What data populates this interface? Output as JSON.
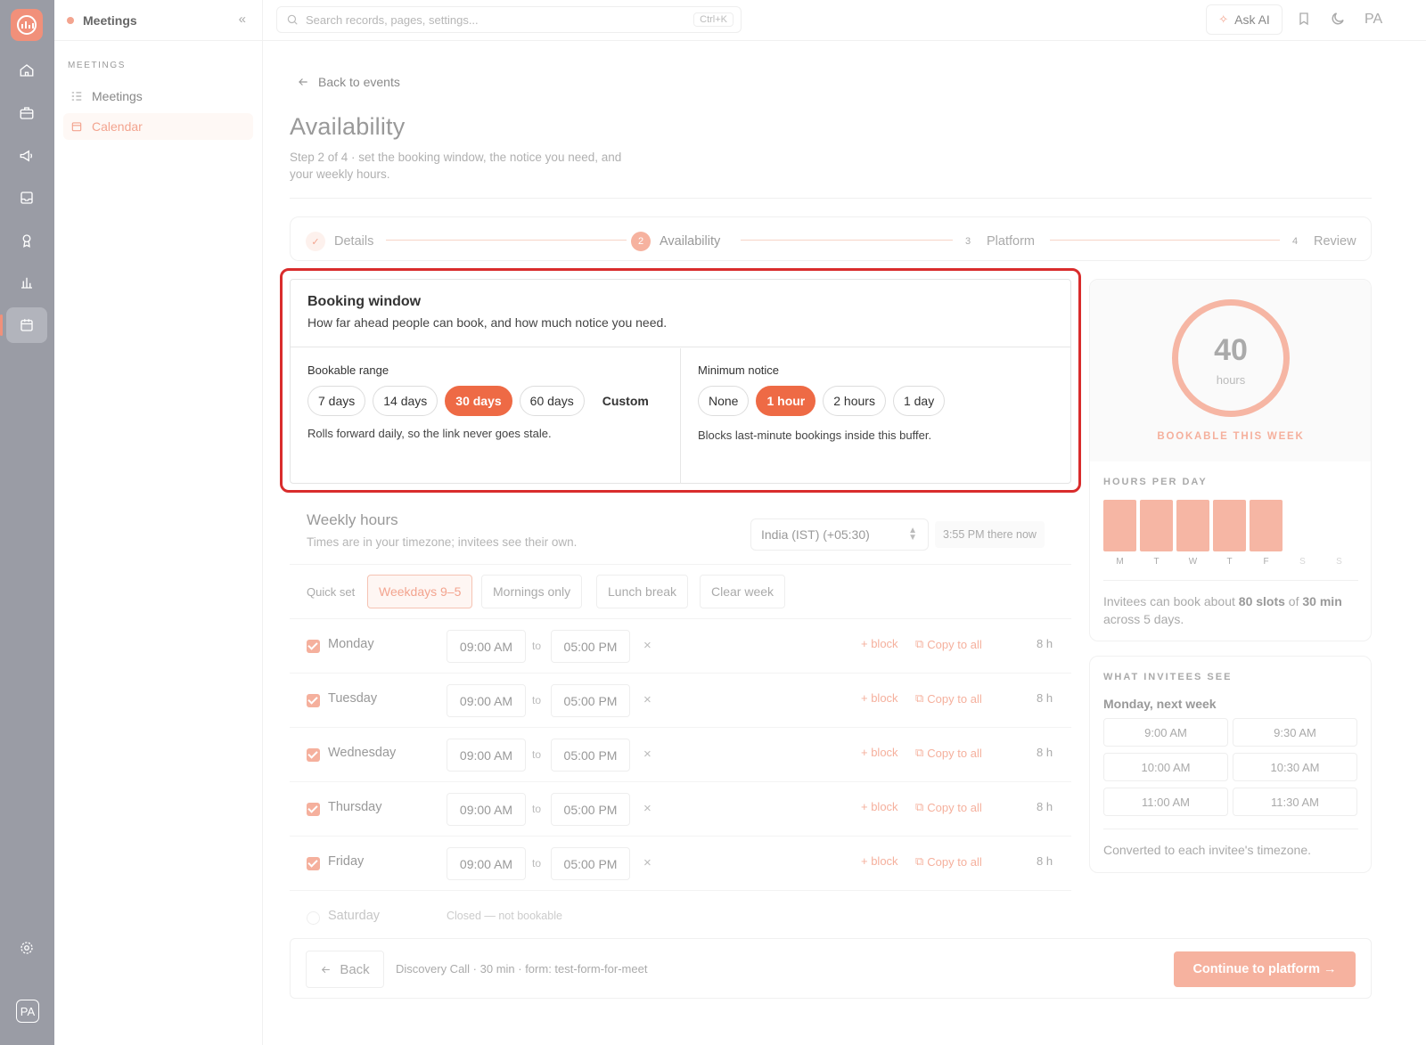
{
  "app": {
    "module": "Meetings",
    "user_initials": "PA"
  },
  "sidebar": {
    "section_label": "MEETINGS",
    "items": [
      {
        "label": "Meetings"
      },
      {
        "label": "Calendar"
      }
    ]
  },
  "topbar": {
    "search_placeholder": "Search records, pages, settings...",
    "shortcut": "Ctrl+K",
    "ask_ai": "Ask AI",
    "avatar": "PA"
  },
  "page": {
    "back_link": "Back to events",
    "title": "Availability",
    "subtitle": "Step 2 of 4 · set the booking window, the notice you need, and your weekly hours."
  },
  "stepper": {
    "steps": [
      {
        "num": "✓",
        "label": "Details",
        "state": "done"
      },
      {
        "num": "2",
        "label": "Availability",
        "state": "current"
      },
      {
        "num": "3",
        "label": "Platform",
        "state": "upcoming"
      },
      {
        "num": "4",
        "label": "Review",
        "state": "upcoming"
      }
    ]
  },
  "booking_window": {
    "title": "Booking window",
    "description": "How far ahead people can book, and how much notice you need.",
    "range": {
      "label": "Bookable range",
      "options": [
        "7 days",
        "14 days",
        "30 days",
        "60 days",
        "Custom"
      ],
      "selected": "30 days",
      "hint": "Rolls forward daily, so the link never goes stale."
    },
    "notice": {
      "label": "Minimum notice",
      "options": [
        "None",
        "1 hour",
        "2 hours",
        "1 day"
      ],
      "selected": "1 hour",
      "hint": "Blocks last-minute bookings inside this buffer."
    }
  },
  "weekly": {
    "title": "Weekly hours",
    "subtitle": "Times are in your timezone; invitees see their own.",
    "timezone": "India (IST) (+05:30)",
    "now": "3:55 PM there now",
    "quick_set_label": "Quick set",
    "quick_set": [
      "Weekdays 9–5",
      "Mornings only",
      "Lunch break",
      "Clear week"
    ],
    "quick_selected": "Weekdays 9–5",
    "to_label": "to",
    "add_block": "+ block",
    "copy_all": "Copy to all",
    "days": [
      {
        "name": "Monday",
        "start": "09:00 AM",
        "end": "05:00 PM",
        "hours": "8 h",
        "enabled": true
      },
      {
        "name": "Tuesday",
        "start": "09:00 AM",
        "end": "05:00 PM",
        "hours": "8 h",
        "enabled": true
      },
      {
        "name": "Wednesday",
        "start": "09:00 AM",
        "end": "05:00 PM",
        "hours": "8 h",
        "enabled": true
      },
      {
        "name": "Thursday",
        "start": "09:00 AM",
        "end": "05:00 PM",
        "hours": "8 h",
        "enabled": true
      },
      {
        "name": "Friday",
        "start": "09:00 AM",
        "end": "05:00 PM",
        "hours": "8 h",
        "enabled": true
      },
      {
        "name": "Saturday",
        "closed_text": "Closed — not bookable",
        "enabled": false
      }
    ]
  },
  "footer": {
    "back": "Back",
    "meta": "Discovery Call · 30 min · form: test-form-for-meet",
    "continue": "Continue to platform →"
  },
  "summary": {
    "hours_value": "40",
    "hours_unit": "hours",
    "caption": "BOOKABLE THIS WEEK",
    "per_day_title": "HOURS PER DAY",
    "per_day": [
      {
        "day": "M",
        "hours": 8
      },
      {
        "day": "T",
        "hours": 8
      },
      {
        "day": "W",
        "hours": 8
      },
      {
        "day": "T",
        "hours": 8
      },
      {
        "day": "F",
        "hours": 8
      },
      {
        "day": "S",
        "hours": 0
      },
      {
        "day": "S",
        "hours": 0
      }
    ],
    "note_pre": "Invitees can book about ",
    "note_slots": "80 slots",
    "note_mid": " of ",
    "note_len": "30 min",
    "note_post": " across 5 days."
  },
  "preview": {
    "title": "WHAT INVITEES SEE",
    "day": "Monday, next week",
    "slots": [
      "9:00 AM",
      "9:30 AM",
      "10:00 AM",
      "10:30 AM",
      "11:00 AM",
      "11:30 AM"
    ],
    "footnote": "Converted to each invitee's timezone."
  },
  "colors": {
    "accent": "#ee6a45",
    "accent_soft": "#f6b6a4",
    "highlight": "#d92c2c",
    "rail": "#9a9ca5"
  }
}
